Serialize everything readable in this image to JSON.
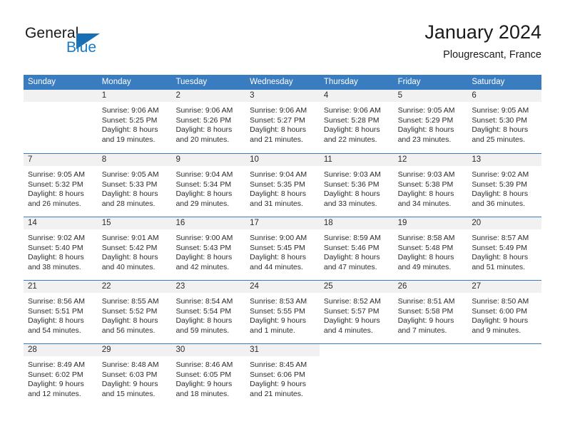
{
  "brand": {
    "general": "General",
    "blue": "Blue",
    "triangle_color": "#1a6fb4"
  },
  "header": {
    "title": "January 2024",
    "subtitle": "Plougrescant, France",
    "accent_color": "#3a7cc0",
    "band_color": "#f1f1f1"
  },
  "weekdays": [
    "Sunday",
    "Monday",
    "Tuesday",
    "Wednesday",
    "Thursday",
    "Friday",
    "Saturday"
  ],
  "weeks": [
    [
      {
        "day": "",
        "sunrise": "",
        "sunset": "",
        "daylight1": "",
        "daylight2": ""
      },
      {
        "day": "1",
        "sunrise": "Sunrise: 9:06 AM",
        "sunset": "Sunset: 5:25 PM",
        "daylight1": "Daylight: 8 hours",
        "daylight2": "and 19 minutes."
      },
      {
        "day": "2",
        "sunrise": "Sunrise: 9:06 AM",
        "sunset": "Sunset: 5:26 PM",
        "daylight1": "Daylight: 8 hours",
        "daylight2": "and 20 minutes."
      },
      {
        "day": "3",
        "sunrise": "Sunrise: 9:06 AM",
        "sunset": "Sunset: 5:27 PM",
        "daylight1": "Daylight: 8 hours",
        "daylight2": "and 21 minutes."
      },
      {
        "day": "4",
        "sunrise": "Sunrise: 9:06 AM",
        "sunset": "Sunset: 5:28 PM",
        "daylight1": "Daylight: 8 hours",
        "daylight2": "and 22 minutes."
      },
      {
        "day": "5",
        "sunrise": "Sunrise: 9:05 AM",
        "sunset": "Sunset: 5:29 PM",
        "daylight1": "Daylight: 8 hours",
        "daylight2": "and 23 minutes."
      },
      {
        "day": "6",
        "sunrise": "Sunrise: 9:05 AM",
        "sunset": "Sunset: 5:30 PM",
        "daylight1": "Daylight: 8 hours",
        "daylight2": "and 25 minutes."
      }
    ],
    [
      {
        "day": "7",
        "sunrise": "Sunrise: 9:05 AM",
        "sunset": "Sunset: 5:32 PM",
        "daylight1": "Daylight: 8 hours",
        "daylight2": "and 26 minutes."
      },
      {
        "day": "8",
        "sunrise": "Sunrise: 9:05 AM",
        "sunset": "Sunset: 5:33 PM",
        "daylight1": "Daylight: 8 hours",
        "daylight2": "and 28 minutes."
      },
      {
        "day": "9",
        "sunrise": "Sunrise: 9:04 AM",
        "sunset": "Sunset: 5:34 PM",
        "daylight1": "Daylight: 8 hours",
        "daylight2": "and 29 minutes."
      },
      {
        "day": "10",
        "sunrise": "Sunrise: 9:04 AM",
        "sunset": "Sunset: 5:35 PM",
        "daylight1": "Daylight: 8 hours",
        "daylight2": "and 31 minutes."
      },
      {
        "day": "11",
        "sunrise": "Sunrise: 9:03 AM",
        "sunset": "Sunset: 5:36 PM",
        "daylight1": "Daylight: 8 hours",
        "daylight2": "and 33 minutes."
      },
      {
        "day": "12",
        "sunrise": "Sunrise: 9:03 AM",
        "sunset": "Sunset: 5:38 PM",
        "daylight1": "Daylight: 8 hours",
        "daylight2": "and 34 minutes."
      },
      {
        "day": "13",
        "sunrise": "Sunrise: 9:02 AM",
        "sunset": "Sunset: 5:39 PM",
        "daylight1": "Daylight: 8 hours",
        "daylight2": "and 36 minutes."
      }
    ],
    [
      {
        "day": "14",
        "sunrise": "Sunrise: 9:02 AM",
        "sunset": "Sunset: 5:40 PM",
        "daylight1": "Daylight: 8 hours",
        "daylight2": "and 38 minutes."
      },
      {
        "day": "15",
        "sunrise": "Sunrise: 9:01 AM",
        "sunset": "Sunset: 5:42 PM",
        "daylight1": "Daylight: 8 hours",
        "daylight2": "and 40 minutes."
      },
      {
        "day": "16",
        "sunrise": "Sunrise: 9:00 AM",
        "sunset": "Sunset: 5:43 PM",
        "daylight1": "Daylight: 8 hours",
        "daylight2": "and 42 minutes."
      },
      {
        "day": "17",
        "sunrise": "Sunrise: 9:00 AM",
        "sunset": "Sunset: 5:45 PM",
        "daylight1": "Daylight: 8 hours",
        "daylight2": "and 44 minutes."
      },
      {
        "day": "18",
        "sunrise": "Sunrise: 8:59 AM",
        "sunset": "Sunset: 5:46 PM",
        "daylight1": "Daylight: 8 hours",
        "daylight2": "and 47 minutes."
      },
      {
        "day": "19",
        "sunrise": "Sunrise: 8:58 AM",
        "sunset": "Sunset: 5:48 PM",
        "daylight1": "Daylight: 8 hours",
        "daylight2": "and 49 minutes."
      },
      {
        "day": "20",
        "sunrise": "Sunrise: 8:57 AM",
        "sunset": "Sunset: 5:49 PM",
        "daylight1": "Daylight: 8 hours",
        "daylight2": "and 51 minutes."
      }
    ],
    [
      {
        "day": "21",
        "sunrise": "Sunrise: 8:56 AM",
        "sunset": "Sunset: 5:51 PM",
        "daylight1": "Daylight: 8 hours",
        "daylight2": "and 54 minutes."
      },
      {
        "day": "22",
        "sunrise": "Sunrise: 8:55 AM",
        "sunset": "Sunset: 5:52 PM",
        "daylight1": "Daylight: 8 hours",
        "daylight2": "and 56 minutes."
      },
      {
        "day": "23",
        "sunrise": "Sunrise: 8:54 AM",
        "sunset": "Sunset: 5:54 PM",
        "daylight1": "Daylight: 8 hours",
        "daylight2": "and 59 minutes."
      },
      {
        "day": "24",
        "sunrise": "Sunrise: 8:53 AM",
        "sunset": "Sunset: 5:55 PM",
        "daylight1": "Daylight: 9 hours",
        "daylight2": "and 1 minute."
      },
      {
        "day": "25",
        "sunrise": "Sunrise: 8:52 AM",
        "sunset": "Sunset: 5:57 PM",
        "daylight1": "Daylight: 9 hours",
        "daylight2": "and 4 minutes."
      },
      {
        "day": "26",
        "sunrise": "Sunrise: 8:51 AM",
        "sunset": "Sunset: 5:58 PM",
        "daylight1": "Daylight: 9 hours",
        "daylight2": "and 7 minutes."
      },
      {
        "day": "27",
        "sunrise": "Sunrise: 8:50 AM",
        "sunset": "Sunset: 6:00 PM",
        "daylight1": "Daylight: 9 hours",
        "daylight2": "and 9 minutes."
      }
    ],
    [
      {
        "day": "28",
        "sunrise": "Sunrise: 8:49 AM",
        "sunset": "Sunset: 6:02 PM",
        "daylight1": "Daylight: 9 hours",
        "daylight2": "and 12 minutes."
      },
      {
        "day": "29",
        "sunrise": "Sunrise: 8:48 AM",
        "sunset": "Sunset: 6:03 PM",
        "daylight1": "Daylight: 9 hours",
        "daylight2": "and 15 minutes."
      },
      {
        "day": "30",
        "sunrise": "Sunrise: 8:46 AM",
        "sunset": "Sunset: 6:05 PM",
        "daylight1": "Daylight: 9 hours",
        "daylight2": "and 18 minutes."
      },
      {
        "day": "31",
        "sunrise": "Sunrise: 8:45 AM",
        "sunset": "Sunset: 6:06 PM",
        "daylight1": "Daylight: 9 hours",
        "daylight2": "and 21 minutes."
      },
      {
        "day": "",
        "sunrise": "",
        "sunset": "",
        "daylight1": "",
        "daylight2": ""
      },
      {
        "day": "",
        "sunrise": "",
        "sunset": "",
        "daylight1": "",
        "daylight2": ""
      },
      {
        "day": "",
        "sunrise": "",
        "sunset": "",
        "daylight1": "",
        "daylight2": ""
      }
    ]
  ]
}
